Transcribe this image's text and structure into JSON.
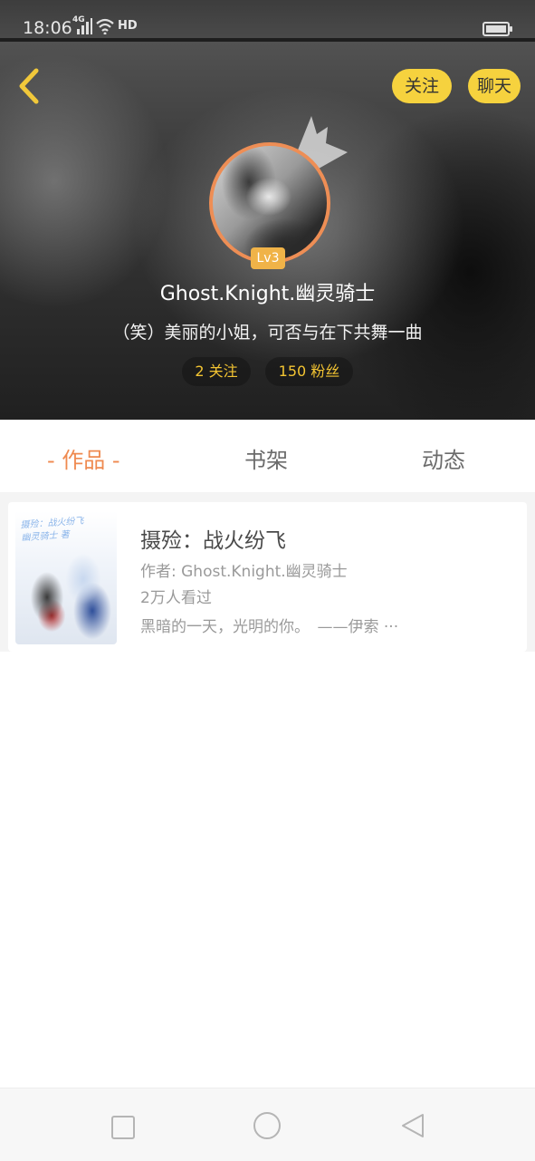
{
  "status": {
    "time": "18:06",
    "network": "4G",
    "hd": "HD",
    "icons": [
      "signal-icon",
      "wifi-icon",
      "battery-icon"
    ]
  },
  "header": {
    "back_icon": "chevron-left-icon",
    "follow_label": "关注",
    "chat_label": "聊天",
    "level": "Lv3",
    "username": "Ghost.Knight.幽灵骑士",
    "motto": "（笑）美丽的小姐，可否与在下共舞一曲",
    "following_label": "2 关注",
    "fans_label": "150 粉丝",
    "crown_icon": "crown-icon"
  },
  "tabs": [
    {
      "label": "- 作品 -",
      "active": true
    },
    {
      "label": "书架",
      "active": false
    },
    {
      "label": "动态",
      "active": false
    }
  ],
  "books": [
    {
      "cover_text_line1": "摄殓：战火纷飞",
      "cover_text_line2": "幽灵骑士 著",
      "title": "摄殓：战火纷飞",
      "author": "作者: Ghost.Knight.幽灵骑士",
      "views": "2万人看过",
      "description": "黑暗的一天，光明的你。　——伊索 ···"
    }
  ],
  "colors": {
    "accent": "#ef8a50",
    "button_yellow": "#f6d23e",
    "stat_text": "#f3c432",
    "level_badge": "#f0b348"
  },
  "navbar": {
    "icons": [
      "recents-icon",
      "home-icon",
      "back-icon"
    ]
  }
}
